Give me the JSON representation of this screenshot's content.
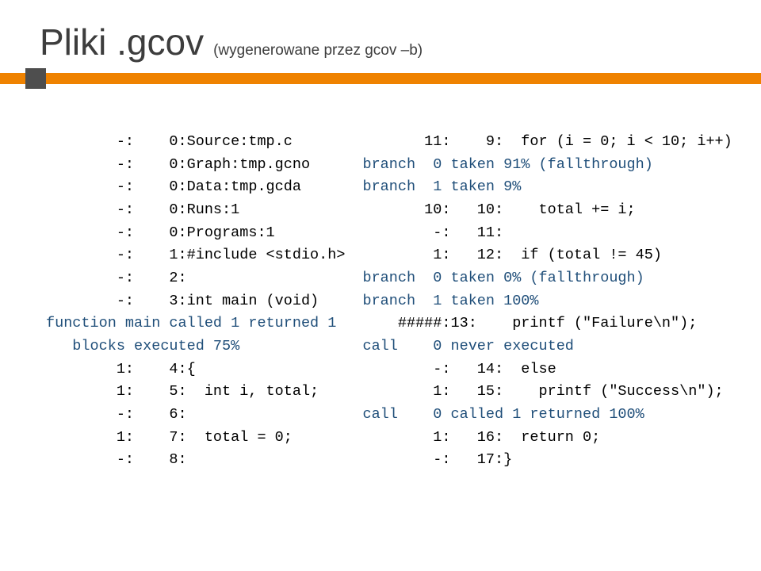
{
  "title": {
    "main": "Pliki .gcov",
    "sub": "(wygenerowane przez gcov –b)"
  },
  "left": {
    "l0": "        -:    0:Source:tmp.c",
    "l1": "        -:    0:Graph:tmp.gcno",
    "l2": "        -:    0:Data:tmp.gcda",
    "l3": "        -:    0:Runs:1",
    "l4": "        -:    0:Programs:1",
    "l5": "        -:    1:#include <stdio.h>",
    "l6": "        -:    2:",
    "l7": "        -:    3:int main (void)",
    "l8": "function main called 1 returned 1\n   blocks executed 75%",
    "l9": "        1:    4:{",
    "l10": "        1:    5:  int i, total;",
    "l11": "        -:    6:",
    "l12": "        1:    7:  total = 0;",
    "l13": "        -:    8:"
  },
  "right": {
    "l0": "       11:    9:  for (i = 0; i < 10; i++)",
    "l1": "branch  0 taken 91% (fallthrough)",
    "l2": "branch  1 taken 9%",
    "l3": "       10:   10:    total += i;",
    "l4": "        -:   11:",
    "l5": "        1:   12:  if (total != 45)",
    "l6": "branch  0 taken 0% (fallthrough)",
    "l7": "branch  1 taken 100%",
    "l8": "    #####:13:    printf (\"Failure\\n\");",
    "l9": "call    0 never executed",
    "l10": "        -:   14:  else",
    "l11": "        1:   15:    printf (\"Success\\n\");",
    "l12": "call    0 called 1 returned 100%",
    "l13": "        1:   16:  return 0;",
    "l14": "        -:   17:}"
  }
}
